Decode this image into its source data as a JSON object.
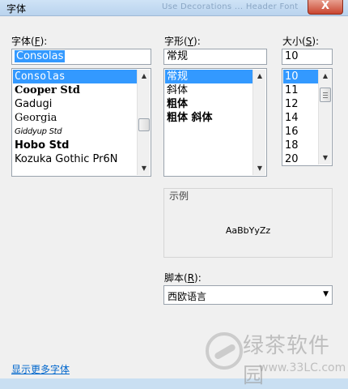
{
  "window": {
    "title": "字体",
    "ghost_title": "Use Decorations ... Header Font",
    "close_label": "X"
  },
  "font": {
    "label_pre": "字体(",
    "label_key": "F",
    "label_post": "):",
    "value": "Consolas",
    "items": [
      "Consolas",
      "Cooper Std",
      "Gadugi",
      "Georgia",
      "Giddyup Std",
      "Hobo Std",
      "Kozuka Gothic Pr6N"
    ]
  },
  "style": {
    "label_pre": "字形(",
    "label_key": "Y",
    "label_post": "):",
    "value": "常规",
    "items": [
      "常规",
      "斜体",
      "粗体",
      "粗体 斜体"
    ]
  },
  "size": {
    "label_pre": "大小(",
    "label_key": "S",
    "label_post": "):",
    "value": "10",
    "items": [
      "10",
      "11",
      "12",
      "14",
      "16",
      "18",
      "20"
    ]
  },
  "preview": {
    "legend": "示例",
    "sample_text": "AaBbYyZz"
  },
  "script": {
    "label_pre": "脚本(",
    "label_key": "R",
    "label_post": "):",
    "value": "西欧语言"
  },
  "more_fonts_link": "显示更多字体",
  "watermark": {
    "text": "绿茶软件园",
    "url": "www.33LC.com"
  },
  "colors": {
    "selection": "#3399ff",
    "link": "#0066cc"
  }
}
